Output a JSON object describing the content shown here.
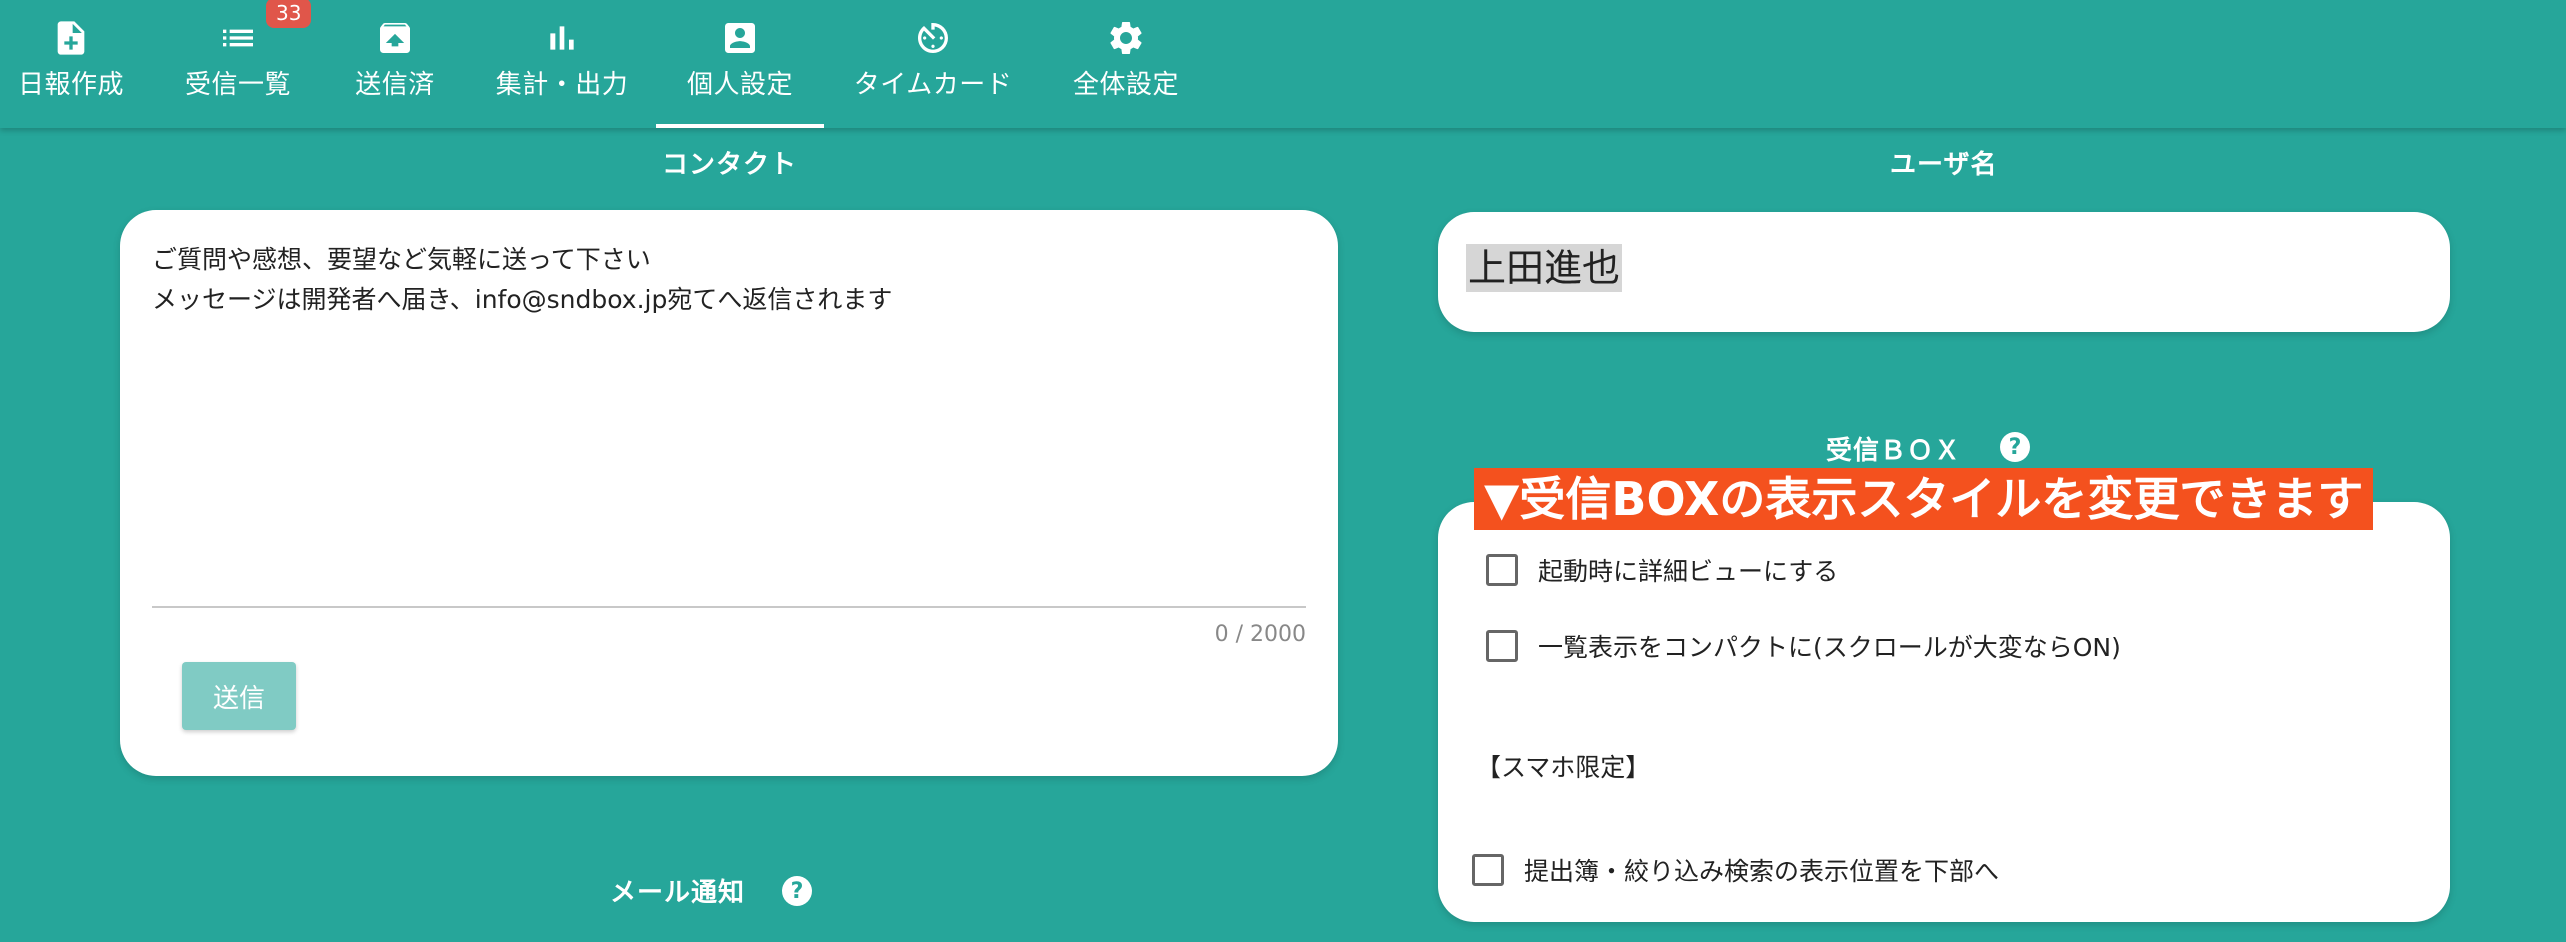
{
  "nav": {
    "items": [
      {
        "label": "日報作成",
        "icon": "file-plus-icon"
      },
      {
        "label": "受信一覧",
        "icon": "list-icon",
        "badge": "33"
      },
      {
        "label": "送信済",
        "icon": "archive-up-icon"
      },
      {
        "label": "集計・出力",
        "icon": "bar-chart-icon"
      },
      {
        "label": "個人設定",
        "icon": "account-box-icon",
        "active": true
      },
      {
        "label": "タイムカード",
        "icon": "timer-icon"
      },
      {
        "label": "全体設定",
        "icon": "gear-icon"
      }
    ]
  },
  "contact": {
    "title": "コンタクト",
    "text": "ご質問や感想、要望など気軽に送って下さい\nメッセージは開発者へ届き、info@sndbox.jp宛てへ返信されます",
    "counter": "0 / 2000",
    "send_label": "送信"
  },
  "user": {
    "title": "ユーザ名",
    "name": "上田進也"
  },
  "inbox": {
    "title": "受信ＢＯＸ",
    "help": "?",
    "banner": "▼受信BOXの表示スタイルを変更できます",
    "option1": "起動時に詳細ビューにする",
    "option2": "一覧表示をコンパクトに(スクロールが大変ならON)",
    "smartphone_label": "【スマホ限定】",
    "option3": "提出簿・絞り込み検索の表示位置を下部へ"
  },
  "mail": {
    "title": "メール通知",
    "help": "?"
  },
  "colors": {
    "primary": "#26a69a",
    "badge": "#e0564a",
    "banner": "#f4511e",
    "button": "#80cbc4"
  }
}
